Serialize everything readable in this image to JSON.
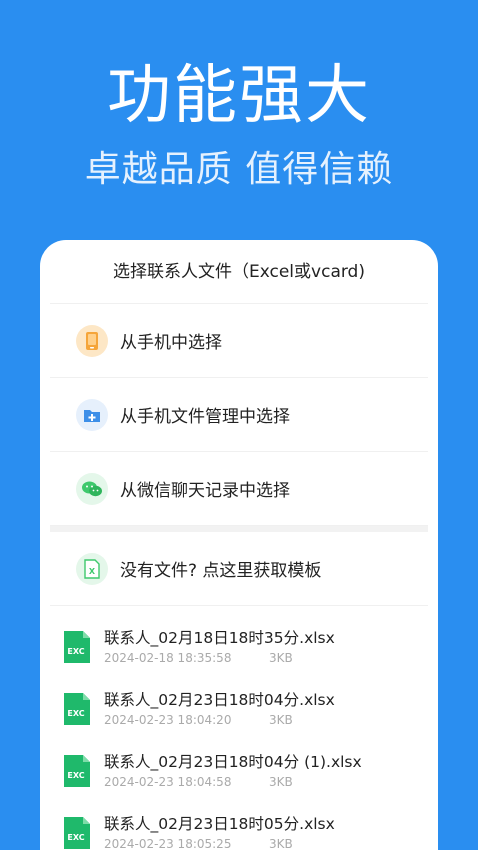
{
  "hero": {
    "title": "功能强大",
    "subtitle": "卓越品质 值得信赖"
  },
  "sheet": {
    "title": "选择联系人文件（Excel或vcard)",
    "options": [
      {
        "label": "从手机中选择",
        "icon": "phone-icon"
      },
      {
        "label": "从手机文件管理中选择",
        "icon": "folder-add-icon"
      },
      {
        "label": "从微信聊天记录中选择",
        "icon": "wechat-icon"
      }
    ],
    "template_label": "没有文件? 点这里获取模板",
    "file_icon_text": "EXC",
    "files": [
      {
        "name": "联系人_02月18日18时35分.xlsx",
        "date": "2024-02-18 18:35:58",
        "size": "3KB"
      },
      {
        "name": "联系人_02月23日18时04分.xlsx",
        "date": "2024-02-23 18:04:20",
        "size": "3KB"
      },
      {
        "name": "联系人_02月23日18时04分 (1).xlsx",
        "date": "2024-02-23 18:04:58",
        "size": "3KB"
      },
      {
        "name": "联系人_02月23日18时05分.xlsx",
        "date": "2024-02-23 18:05:25",
        "size": "3KB"
      }
    ]
  },
  "colors": {
    "background": "#2a8ef0",
    "excel_green": "#1fb96b",
    "phone_orange": "#f5a53a",
    "folder_blue": "#3d8fe8",
    "wechat_green": "#3fc96d"
  }
}
